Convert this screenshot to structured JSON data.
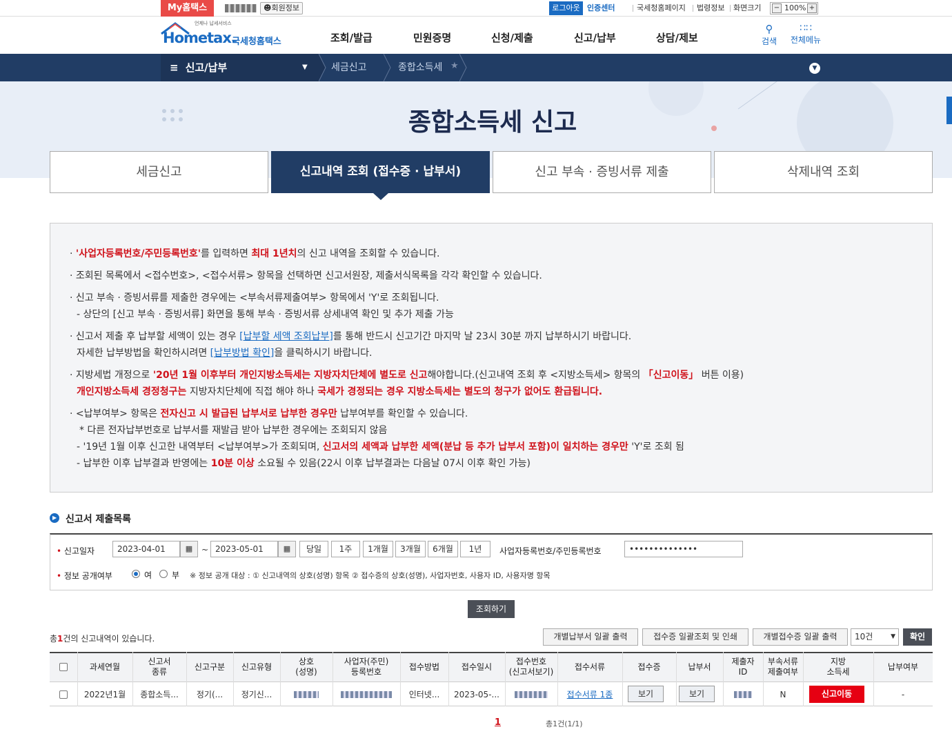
{
  "topbar": {
    "my_hometax": "My홈택스",
    "member_info": "회원정보",
    "logout": "로그아웃",
    "cert_center": "인증센터",
    "links": [
      "국세청홈페이지",
      "법령정보",
      "화면크기"
    ],
    "zoom": "100%",
    "zoom_minus": "−",
    "zoom_plus": "+"
  },
  "header": {
    "logo_sub": "언제나 납세서비스",
    "logo_main": "Hometax.",
    "logo_kr": "국세청홈택스",
    "menu": [
      "조회/발급",
      "민원증명",
      "신청/제출",
      "신고/납부",
      "상담/제보"
    ],
    "search": "검색",
    "all_menu": "전체메뉴"
  },
  "nav": {
    "current": "신고/납부",
    "crumbs": [
      "세금신고",
      "종합소득세"
    ]
  },
  "page_title": "종합소득세 신고",
  "tabs": [
    "세금신고",
    "신고내역 조회 (접수증 · 납부서)",
    "신고 부속 · 증빙서류 제출",
    "삭제내역 조회"
  ],
  "notice": {
    "l1_a": "'사업자등록번호/주민등록번호'",
    "l1_b": "를 입력하면 ",
    "l1_c": "최대 1년치",
    "l1_d": "의 신고 내역을 조회할 수 있습니다.",
    "l2": "조회된 목록에서 <접수번호>, <접수서류> 항목을 선택하면 신고서원장, 제출서식목록을 각각 확인할 수 있습니다.",
    "l3": "신고 부속 · 증빙서류를 제출한 경우에는 <부속서류제출여부> 항목에서 'Y'로 조회됩니다.",
    "l3_sub": "- 상단의 [신고 부속 · 증빙서류] 화면을 통해 부속 · 증빙서류 상세내역 확인 및 추가 제출 가능",
    "l4_a": "신고서 제출 후 납부할 세액이 있는 경우 ",
    "l4_link": "[납부할 세액 조회납부]",
    "l4_b": "를 통해 반드시 신고기간 마지막 날 23시 30분 까지 납부하시기 바랍니다.",
    "l4_c": "자세한 납부방법을 확인하시려면 ",
    "l4_link2": "[납부방법 확인]",
    "l4_d": "을 클릭하시기 바랍니다.",
    "l5_a": "지방세법 개정으로 ",
    "l5_b": "'20년 1월 이후부터 개인지방소득세는 지방자치단체에 별도로 신고",
    "l5_c": "해야합니다.(신고내역 조회 후 <지방소득세> 항목의 ",
    "l5_d": "「신고이동」",
    "l5_e": " 버튼 이용)",
    "l5_f": "개인지방소득세 경정청구는",
    "l5_g": " 지방자치단체에 직접 해야 하나 ",
    "l5_h": "국세가 경정되는 경우 지방소득세는 별도의 청구가 없어도 환급됩니다.",
    "l6_a": "<납부여부> 항목은 ",
    "l6_b": "전자신고 시 발급된 납부서로 납부한 경우만",
    "l6_c": " 납부여부를 확인할 수 있습니다.",
    "l6_s1": "* 다른 전자납부번호로 납부서를 재발급 받아 납부한 경우에는 조회되지 않음",
    "l6_s2_a": "- '19년 1월 이후 신고한 내역부터 <납부여부>가 조회되며, ",
    "l6_s2_b": "신고서의 세액과 납부한 세액(분납 등 추가 납부서 포함)이 일치하는 경우만",
    "l6_s2_c": " 'Y'로 조회 됨",
    "l6_s3_a": "- 납부한 이후 납부결과 반영에는 ",
    "l6_s3_b": "10분 이상",
    "l6_s3_c": " 소요될 수 있음(22시 이후 납부결과는 다음날 07시 이후 확인 가능)"
  },
  "section_title": "신고서 제출목록",
  "search": {
    "date_label": "신고일자",
    "date_from": "2023-04-01",
    "date_to": "2023-05-01",
    "tilde": "~",
    "periods": [
      "당일",
      "1주",
      "1개월",
      "3개월",
      "6개월",
      "1년"
    ],
    "id_label": "사업자등록번호/주민등록번호",
    "id_value": "••••••••••••••",
    "public_label": "정보 공개여부",
    "yes": "여",
    "no": "부",
    "public_note": "※ 정보 공개 대상 : ① 신고내역의 상호(성명) 항목 ② 접수증의 상호(성명), 사업자번호, 사용자 ID, 사용자명 항목",
    "search_button": "조회하기"
  },
  "list": {
    "total_a": "총",
    "total_count": "1",
    "total_b": "건의 신고내역이 있습니다.",
    "actions": [
      "개별납부서 일괄 출력",
      "접수증 일괄조회 및 인쇄",
      "개별접수증 일괄 출력"
    ],
    "page_size": "10건",
    "confirm": "확인",
    "headers": [
      "과세연월",
      "신고서\n종류",
      "신고구분",
      "신고유형",
      "상호\n(성명)",
      "사업자(주민)\n등록번호",
      "접수방법",
      "접수일시",
      "접수번호\n(신고서보기)",
      "접수서류",
      "접수증",
      "납부서",
      "제출자\nID",
      "부속서류\n제출여부",
      "지방\n소득세",
      "납부여부"
    ],
    "row": {
      "period": "2022년1월",
      "kind": "종합소득...",
      "category": "정기(...",
      "type": "정기신...",
      "method": "인터넷...",
      "datetime": "2023-05-...",
      "docs": "접수서류 1종",
      "receipt": "보기",
      "payment": "보기",
      "attach": "N",
      "local_tax": "신고이동",
      "paid": "-"
    },
    "page": "1",
    "page_total": "총1건(1/1)"
  }
}
